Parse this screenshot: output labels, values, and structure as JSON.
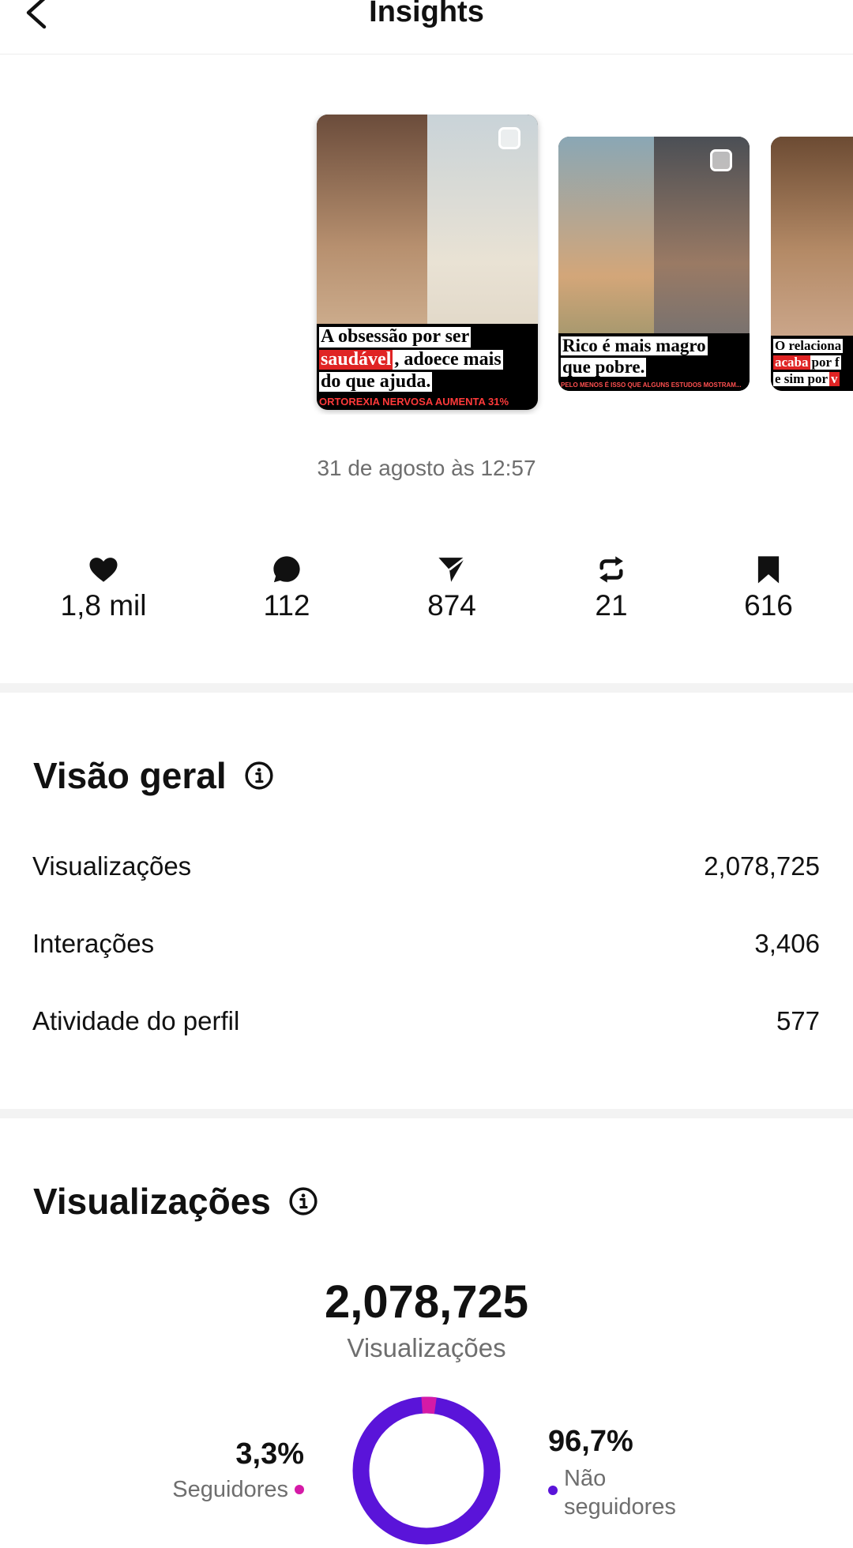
{
  "header": {
    "title": "Insights"
  },
  "posts": [
    {
      "caption_lines": [
        "A obsessão por ser",
        "saudável",
        ", adoece mais",
        "do que ajuda."
      ],
      "subcaption": "ORTOREXIA NERVOSA AUMENTA 31%"
    },
    {
      "caption_lines": [
        "Rico é mais magro",
        "que pobre."
      ],
      "subcaption": "PELO MENOS É ISSO QUE ALGUNS ESTUDOS MOSTRAM..."
    },
    {
      "caption_lines": [
        "O relaciona",
        "acaba",
        " por f",
        "e sim por ",
        "v"
      ]
    }
  ],
  "date": "31 de agosto às 12:57",
  "stats": [
    {
      "icon": "heart-icon",
      "value": "1,8 mil"
    },
    {
      "icon": "comment-icon",
      "value": "112"
    },
    {
      "icon": "share-icon",
      "value": "874"
    },
    {
      "icon": "repost-icon",
      "value": "21"
    },
    {
      "icon": "bookmark-icon",
      "value": "616"
    }
  ],
  "overview": {
    "title": "Visão geral",
    "rows": [
      {
        "label": "Visualizações",
        "value": "2,078,725"
      },
      {
        "label": "Interações",
        "value": "3,406"
      },
      {
        "label": "Atividade do perfil",
        "value": "577"
      }
    ]
  },
  "views": {
    "title": "Visualizações",
    "total": "2,078,725",
    "total_label": "Visualizações",
    "followers_pct": "3,3%",
    "followers_label": "Seguidores",
    "non_followers_pct": "96,7%",
    "non_followers_label_1": "Não",
    "non_followers_label_2": "seguidores",
    "followers_share": 0.033,
    "colors": {
      "followers": "#d51aa7",
      "non_followers": "#5a14d9"
    }
  }
}
